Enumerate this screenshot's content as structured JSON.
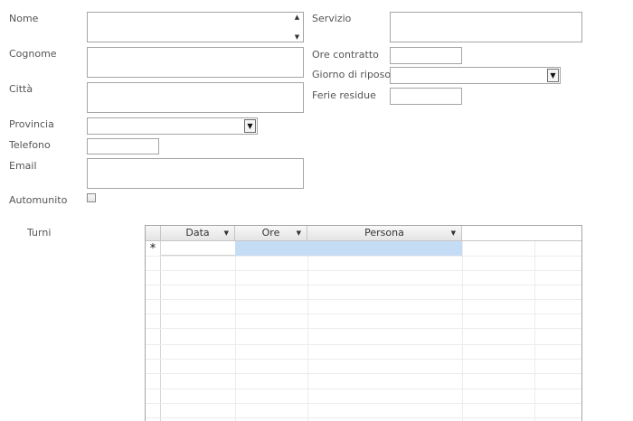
{
  "form": {
    "nome": {
      "label": "Nome",
      "value": ""
    },
    "cognome": {
      "label": "Cognome",
      "value": ""
    },
    "citta": {
      "label": "Città",
      "value": ""
    },
    "provincia": {
      "label": "Provincia",
      "value": ""
    },
    "telefono": {
      "label": "Telefono",
      "value": ""
    },
    "email": {
      "label": "Email",
      "value": ""
    },
    "automunito": {
      "label": "Automunito",
      "checked": false
    },
    "servizio": {
      "label": "Servizio",
      "value": ""
    },
    "ore_contratto": {
      "label": "Ore contratto",
      "value": ""
    },
    "giorno_riposo": {
      "label": "Giorno di riposo",
      "value": ""
    },
    "ferie_residue": {
      "label": "Ferie residue",
      "value": ""
    }
  },
  "turni": {
    "label": "Turni",
    "columns": [
      "Data",
      "Ore",
      "Persona"
    ],
    "new_row_marker": "*",
    "selected_color": "#c5dcf5"
  },
  "icons": {
    "scroll_up": "▲",
    "scroll_down": "▼",
    "dropdown": "▼",
    "sort": "▼"
  }
}
